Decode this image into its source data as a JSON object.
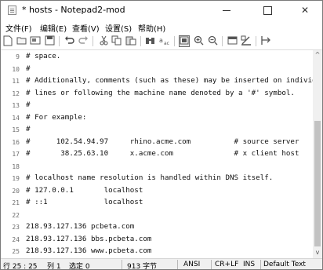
{
  "window": {
    "title": "* hosts - Notepad2-mod",
    "minimize_label": "—",
    "maximize_label": "",
    "close_label": "✕"
  },
  "menu": [
    "文件(F)",
    "编辑(E)",
    "查看(V)",
    "设置(S)",
    "帮助(H)"
  ],
  "toolbar": {
    "icons": [
      "new-file-icon",
      "open-folder-icon",
      "browse-icon",
      "save-icon",
      "undo-icon",
      "redo-icon",
      "cut-icon",
      "copy-icon",
      "paste-icon",
      "find-icon",
      "replace-icon",
      "word-wrap-icon",
      "zoom-in-icon",
      "zoom-out-icon",
      "schemes-icon",
      "customize-icon",
      "exit-icon"
    ]
  },
  "editor": {
    "lines": [
      {
        "num": "9",
        "text": "# space."
      },
      {
        "num": "10",
        "text": "#"
      },
      {
        "num": "11",
        "text": "# Additionally, comments (such as these) may be inserted on individual"
      },
      {
        "num": "12",
        "text": "# lines or following the machine name denoted by a '#' symbol."
      },
      {
        "num": "13",
        "text": "#"
      },
      {
        "num": "14",
        "text": "# For example:"
      },
      {
        "num": "15",
        "text": "#"
      },
      {
        "num": "16",
        "text": "#      102.54.94.97     rhino.acme.com          # source server"
      },
      {
        "num": "17",
        "text": "#       38.25.63.10     x.acme.com              # x client host"
      },
      {
        "num": "18",
        "text": ""
      },
      {
        "num": "19",
        "text": "# localhost name resolution is handled within DNS itself."
      },
      {
        "num": "20",
        "text": "# 127.0.0.1       localhost"
      },
      {
        "num": "21",
        "text": "# ::1             localhost"
      },
      {
        "num": "22",
        "text": ""
      },
      {
        "num": "23",
        "text": "218.93.127.136 pcbeta.com"
      },
      {
        "num": "24",
        "text": "218.93.127.136 bbs.pcbeta.com"
      },
      {
        "num": "25",
        "text": "218.93.127.136 www.pcbeta.com"
      }
    ]
  },
  "scrollbar": {
    "up_arrow": "^",
    "down_arrow": "v"
  },
  "statusbar": {
    "position": "行 25 : 25",
    "column": "列 1",
    "selection": "选定 0",
    "size": "913 字节",
    "encoding": "ANSI",
    "line_endings": "CR+LF",
    "insert_mode": "INS",
    "scheme": "Default Text"
  }
}
